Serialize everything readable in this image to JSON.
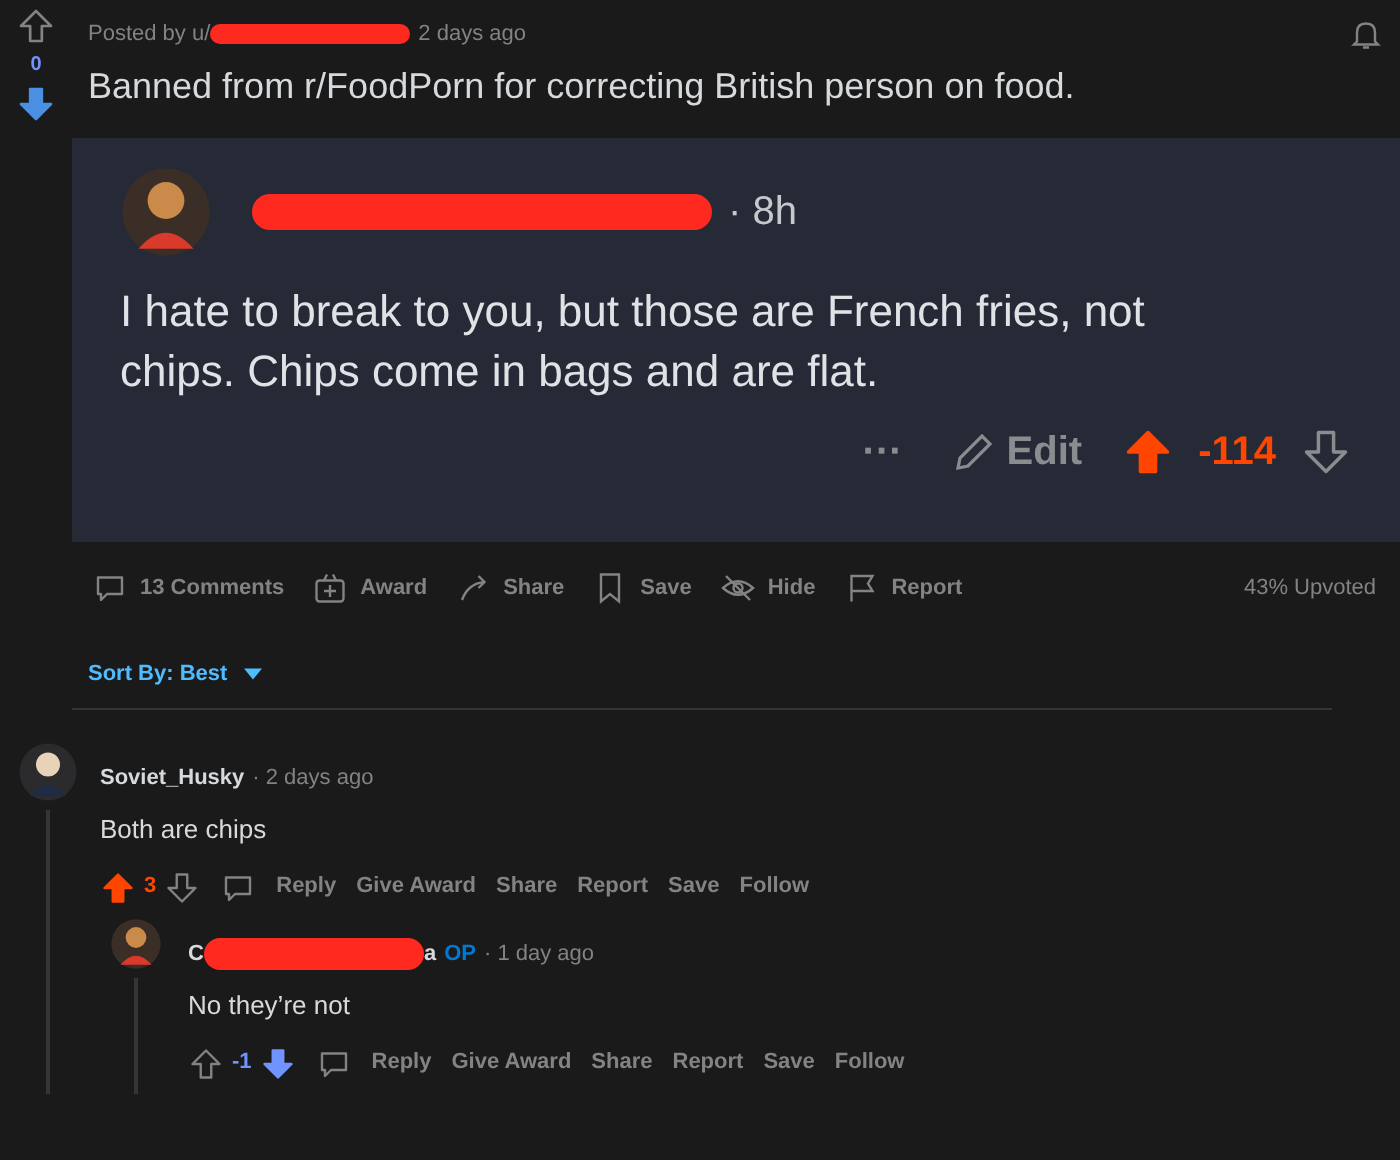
{
  "post": {
    "posted_by": "Posted by u/",
    "age": "2 days ago",
    "title": "Banned from r/FoodPorn for correcting British person on food.",
    "score": "0",
    "upvoted": false,
    "downvoted": true,
    "upvoted_pct": "43% Upvoted"
  },
  "embedded_comment": {
    "age": "· 8h",
    "body": "I hate to break to you, but those are French fries, not chips. Chips come in bags and are flat.",
    "more": "···",
    "edit": "Edit",
    "score": "-114",
    "upvoted": true,
    "downvoted": false
  },
  "actions": [
    {
      "kind": "comments",
      "label": "13 Comments"
    },
    {
      "kind": "award",
      "label": "Award"
    },
    {
      "kind": "share",
      "label": "Share"
    },
    {
      "kind": "save",
      "label": "Save"
    },
    {
      "kind": "hide",
      "label": "Hide"
    },
    {
      "kind": "report",
      "label": "Report"
    }
  ],
  "sort": "Sort By: Best",
  "comments": [
    {
      "author": "Soviet_Husky",
      "age": "· 2 days ago",
      "body": "Both are chips",
      "score": "3",
      "upvoted": true,
      "downvoted": false,
      "redacted": false,
      "actions": [
        "Reply",
        "Give Award",
        "Share",
        "Report",
        "Save",
        "Follow"
      ],
      "replies": [
        {
          "author": "C",
          "author_tail": "a",
          "op": "OP",
          "age": "· 1 day ago",
          "body": "No they’re not",
          "score": "-1",
          "upvoted": false,
          "downvoted": true,
          "redacted": true,
          "actions": [
            "Reply",
            "Give Award",
            "Share",
            "Report",
            "Save",
            "Follow"
          ]
        }
      ]
    }
  ]
}
